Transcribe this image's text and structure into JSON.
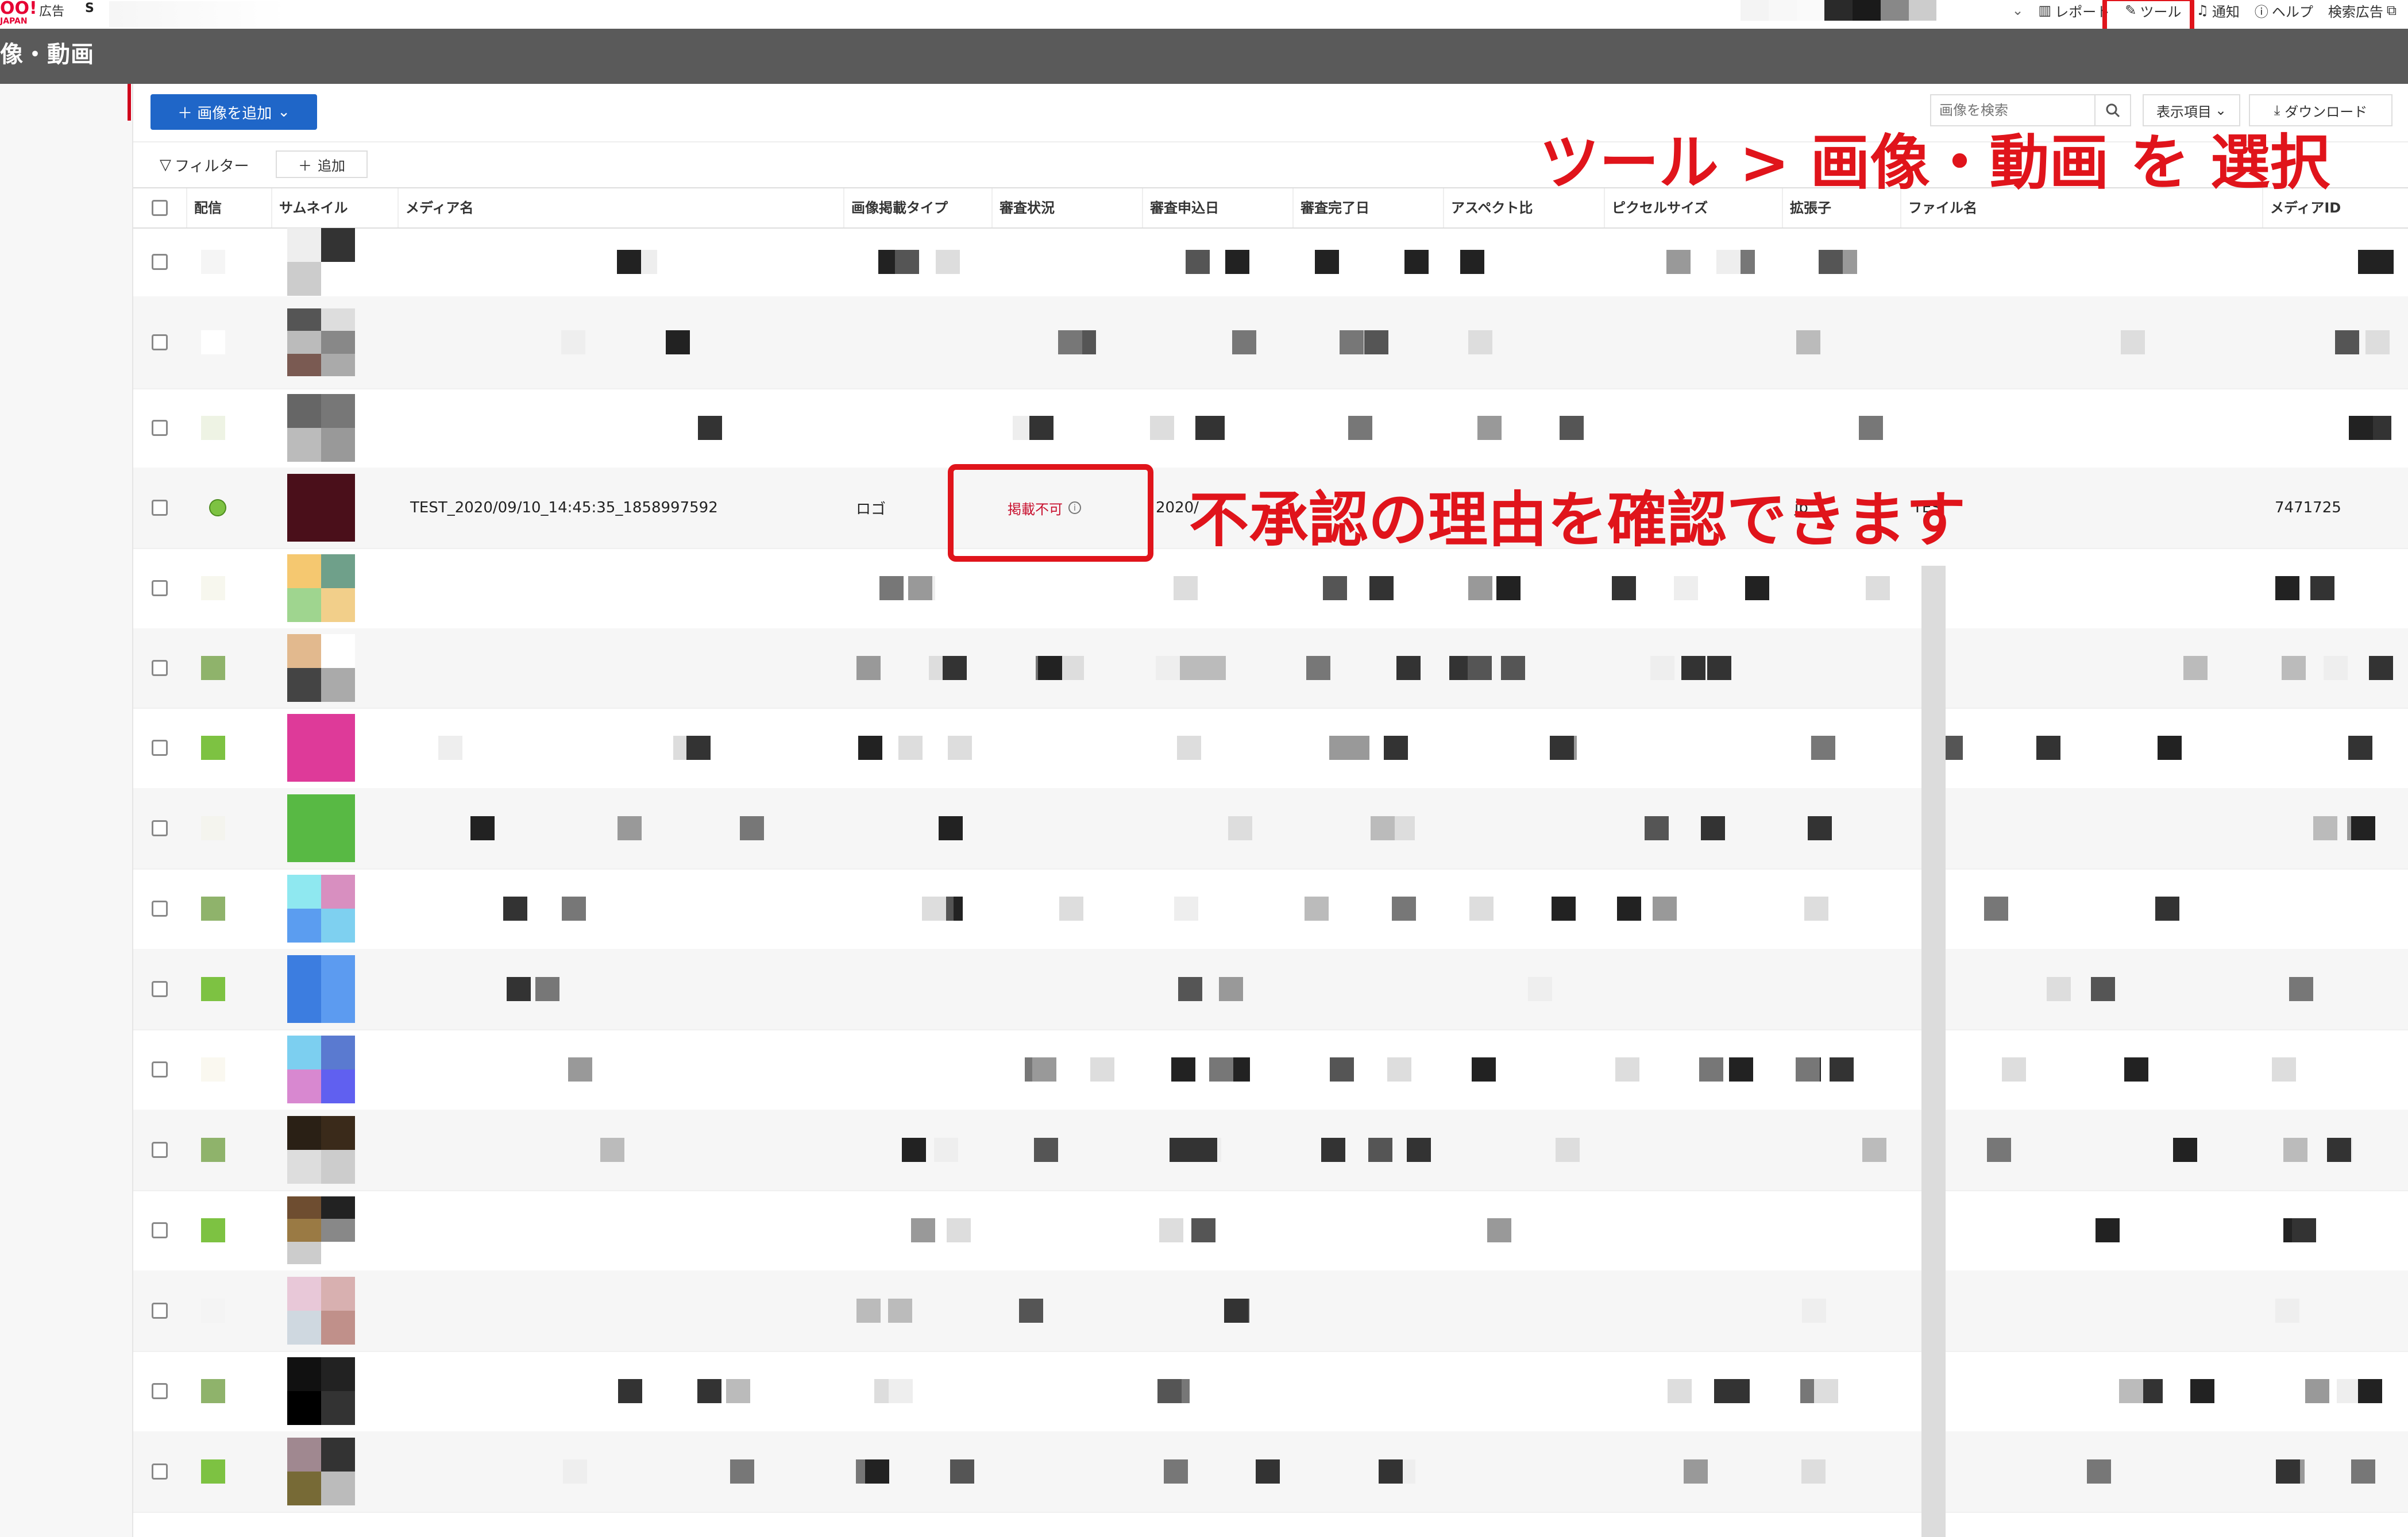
{
  "header": {
    "logo_text": "OO!",
    "logo_sub": "JAPAN",
    "logo_label": "広告",
    "account_fragment": "S",
    "nav": {
      "report": "レポート",
      "tools": "ツール",
      "notify": "通知",
      "help": "ヘルプ",
      "search_ads": "検索広告"
    }
  },
  "page": {
    "title": "像・動画"
  },
  "toolbar": {
    "add_image": "＋ 画像を追加",
    "search_placeholder": "画像を検索",
    "columns": "表示項目",
    "download": "ダウンロード"
  },
  "filter": {
    "filter_label": "フィルター",
    "add_label": "追加"
  },
  "table": {
    "columns": [
      "配信",
      "サムネイル",
      "メディア名",
      "画像掲載タイプ",
      "審査状況",
      "審査申込日",
      "審査完了日",
      "アスペクト比",
      "ピクセルサイズ",
      "拡張子",
      "ファイル名",
      "メディアID"
    ],
    "featured_row": {
      "media_name": "TEST_2020/09/10_14:45:35_1858997592",
      "image_type": "ロゴ",
      "review_status": "掲載不可",
      "apply_date_fragment": "2020/",
      "ext_fragment": "jp",
      "file_name_fragment": "TES",
      "media_id": "7471725"
    }
  },
  "annotations": {
    "select_tool": "ツール > 画像・動画 を 選択",
    "check_reason": "不承認の理由を確認できます"
  },
  "colors": {
    "primary": "#1f66c8",
    "annotation_red": "#e0141b",
    "status_ng": "#c8102e",
    "header_gray": "#5a5a5a",
    "active_green": "#7dc242"
  }
}
